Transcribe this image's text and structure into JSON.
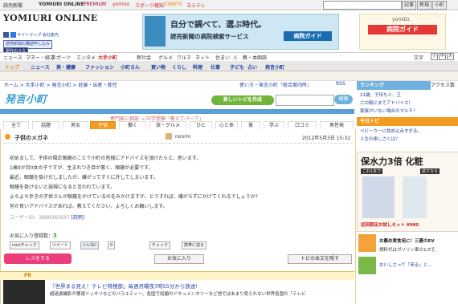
{
  "topnav": {
    "left": "読売新聞",
    "links": [
      "YOMIURI ONLINE",
      "PREMIUM",
      "yorimo",
      "スポーツ報知",
      "STARTS",
      "ヨミテレ"
    ],
    "right": [
      "記事",
      "新規",
      "小町"
    ]
  },
  "header": {
    "site_title": "YOMIURI ONLINE",
    "sitemap": "サイトマップ",
    "company": "会社案内",
    "btn1": "読売新聞の購読申し込み",
    "btn2": "現代のメカ",
    "ad_text1": "自分で調べて、選ぶ時代。",
    "ad_text2": "読売新聞の病院検索サービス",
    "ad_text3": "病院ガイド",
    "ad2_title": "yomiDr.",
    "ad2_text": "病院ガイド"
  },
  "categories": {
    "row1": [
      "ニュース",
      "マネー・経済",
      "スポーツ",
      "エンタメ",
      "大手小町",
      "新社会",
      "グルメ",
      "クルマ",
      "ネット",
      "住まい",
      "人",
      "教・本",
      "朗読"
    ],
    "row2": [
      "トップ",
      "ニュース",
      "美・健康",
      "ファッション",
      "小町さん",
      "買い物",
      "くらし",
      "料理",
      "仕事",
      "子ども",
      "占い",
      "発言小町"
    ],
    "font_size_label": "文字"
  },
  "breadcrumb": "ホーム > 大手小町 > 発言小町 > 妊娠・出産・育児",
  "breadcrumb_right": [
    "使い方・発言小町「総合案内所」",
    "RSS"
  ],
  "komachi_logo": "発言小町",
  "new_topic": "新しいトピを作成",
  "search_btn": "検索",
  "subline": "専門家に相談 → 中学受験「教えてパーク」",
  "tabs": [
    "全て",
    "話題",
    "男女",
    "子供",
    "働く",
    "旅・グルメ",
    "ひと",
    "心と体",
    "美",
    "学ぶ",
    "口コミ",
    "男性発"
  ],
  "question": {
    "title": "子供のメガネ",
    "author": "nonrin",
    "date": "2012年5月3日 15:32",
    "body": [
      "初めまして、子供の矯正眼鏡のことで小町の皆様にアドバイスを頂けたらと、思います。",
      "1歳9か月0女の子ですが、生まれつき目が悪く、眼鏡が必要です。",
      "最近、眼鏡を掛けだしましたが、嫌がってすぐに外してしまいます。",
      "眼鏡を掛けないと弱視になると言われています。",
      "よちよち歩きの子供さんが眼鏡をかけているのをみかけますが、どうすれば、嫌がらずにかけてくれるでしょうか?",
      "何か良いアドバイスがあれば、教えてください。よろしくお願いします。"
    ],
    "user_id": "ユーザーID：3889363937",
    "user_link": "[説明]",
    "fav_count_label": "お気に入り登録数：",
    "fav_count": "3",
    "social": [
      "mixiチェック",
      "ツイート",
      "いいね!",
      "0",
      "チェック",
      "携帯に送る"
    ],
    "reply_btn": "レスをする",
    "fav_btn": "お気に入り",
    "topic_text_btn": "トピの本文を隠す"
  },
  "pr": {
    "label": "PR",
    "headline": "『世界まる見え！テレビ特捜部』毎週月曜夜7時55分から放送!",
    "text": "超過激撮影が悪運ドッキリなどのバラエティー、各国で話題のドキュメンタリーなど他ではあまり見られない世界各国の「テレビ"
  },
  "right": {
    "ranking_title": "ランキング",
    "access_label": "アクセス数",
    "ranking_items": [
      "21歳、子持ち人、王",
      "二の腕にまでアドバイス！",
      "家族がいない場合のマルチ！"
    ],
    "today_title": "今日トピ",
    "today_items": [
      "ベビーカーに詰め込みすぎる。",
      "人生の楽しさとは？"
    ],
    "ad_headline": "保水力3倍 化粧",
    "ad_tag": "これ1本で",
    "ad_cta": "試すなら",
    "ad_footer": "初回限定お試しセット",
    "ad_price": "¥980",
    "news_title": "お薦め実食用に！三菱のEV",
    "news_item2": "燃料代はガソリン車の1/3で、",
    "news_item3": "おいしさって「来る」と…"
  }
}
